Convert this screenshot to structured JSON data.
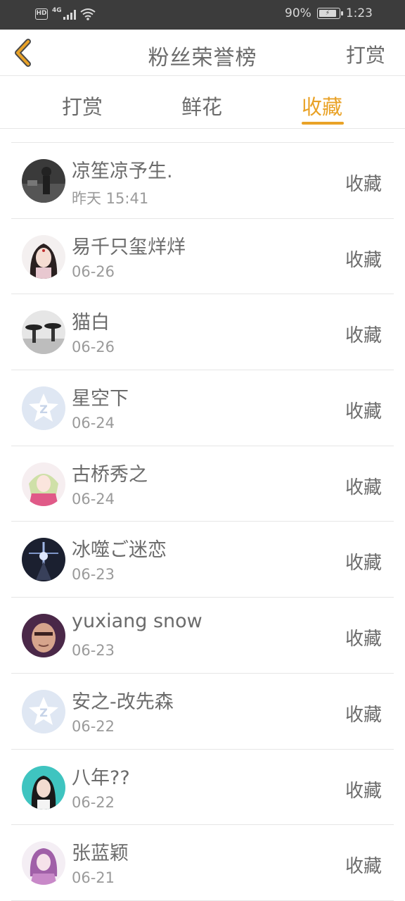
{
  "status_bar": {
    "hd": "HD",
    "network": "4G",
    "battery": "90%",
    "time": "1:23"
  },
  "header": {
    "title": "粉丝荣誉榜",
    "right_link": "打赏",
    "accent_color": "#e9a227"
  },
  "tabs": [
    {
      "label": "打赏",
      "active": false
    },
    {
      "label": "鲜花",
      "active": false
    },
    {
      "label": "收藏",
      "active": true
    }
  ],
  "fans": [
    {
      "name": "凉笙凉予生.",
      "date": "昨天 15:41",
      "action": "收藏",
      "avatar": "photo-avatar-dark"
    },
    {
      "name": "易千只玺烊烊",
      "date": "06-26",
      "action": "收藏",
      "avatar": "anime-girl-avatar"
    },
    {
      "name": "猫白",
      "date": "06-26",
      "action": "收藏",
      "avatar": "rain-umbrella-avatar"
    },
    {
      "name": "星空下",
      "date": "06-24",
      "action": "收藏",
      "avatar": "default-qq-avatar"
    },
    {
      "name": "古桥秀之",
      "date": "06-24",
      "action": "收藏",
      "avatar": "anime-pink-avatar"
    },
    {
      "name": "冰噬ご迷恋",
      "date": "06-23",
      "action": "收藏",
      "avatar": "dark-figure-avatar"
    },
    {
      "name": "yuxiang snow",
      "date": "06-23",
      "action": "收藏",
      "avatar": "face-photo-avatar"
    },
    {
      "name": "安之-改先森",
      "date": "06-22",
      "action": "收藏",
      "avatar": "default-qq-avatar"
    },
    {
      "name": "八年??",
      "date": "06-22",
      "action": "收藏",
      "avatar": "girl-photo-avatar"
    },
    {
      "name": "张蓝颖",
      "date": "06-21",
      "action": "收藏",
      "avatar": "purple-anime-avatar"
    }
  ]
}
